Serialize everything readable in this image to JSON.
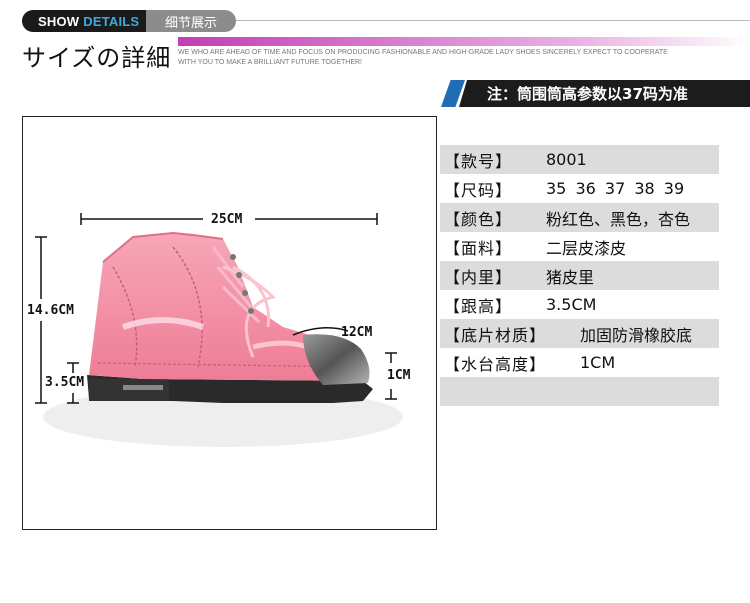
{
  "header": {
    "tab_show": "SHOW",
    "tab_details": "DETAILS",
    "tab_cn": "细节展示",
    "title_jp": "サイズの詳細",
    "slogan": "WE WHO ARE AHEAD OF TIME AND FOCUS ON PRODUCING FASHIONABLE AND HIGH-GRADE LADY SHOES SINCERELY EXPECT TO COOPERATE WITH YOU TO MAKE A BRILLIANT FUTURE TOGETHER!"
  },
  "note": "注：筒围筒高参数以37码为准",
  "dimensions": {
    "length": "25CM",
    "shaft_height": "14.6CM",
    "toe": "12CM",
    "heel": "3.5CM",
    "platform": "1CM"
  },
  "specs": [
    {
      "key": "【款号】",
      "value": "8001",
      "shaded": true
    },
    {
      "key": "【尺码】",
      "value": "35 36 37 38 39",
      "shaded": false
    },
    {
      "key": "【颜色】",
      "value": "粉红色、黑色，杏色",
      "shaded": true
    },
    {
      "key": "【面料】",
      "value": "二层皮漆皮",
      "shaded": false
    },
    {
      "key": "【内里】",
      "value": "猪皮里",
      "shaded": true
    },
    {
      "key": "【跟高】",
      "value": "3.5CM",
      "shaded": false
    },
    {
      "key": "【底片材质】",
      "value": "加固防滑橡胶底",
      "shaded": true
    },
    {
      "key": "【水台高度】",
      "value": "1CM",
      "shaded": false
    },
    {
      "key": "",
      "value": "",
      "shaded": true
    }
  ],
  "colors": {
    "accent_blue": "#3fa9e0",
    "banner_blue": "#1f6db4",
    "shoe_pink": "#f48fa5",
    "toe_metal": "#6e6e6e"
  }
}
